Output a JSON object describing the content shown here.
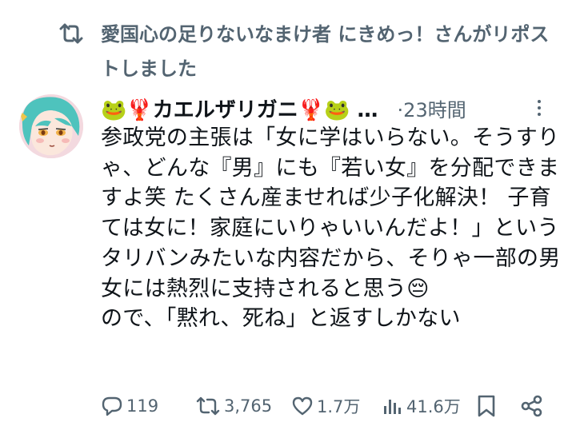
{
  "repost": {
    "icon": "repost-icon",
    "text": "愛国心の足りないなまけ者 にきめっ！さんがリポストしました"
  },
  "post": {
    "author": {
      "avatar": "avatar",
      "display_name": "🐸🦞カエルザリガニ🦞🐸 …"
    },
    "time": "·23時間",
    "body_paragraphs": [
      "参政党の主張は「女に学はいらない。そうすりゃ、どんな『男』にも『若い女』を分配できますよ笑 たくさん産ませれば少子化解決！ 子育ては女に！家庭にいりゃいいんだよ！」というタリバンみたいな内容だから、そりゃ一部の男女には熱烈に支持されると思う😔",
      "ので、「黙れ、死ね」と返すしかない"
    ]
  },
  "actions": {
    "reply": {
      "icon": "reply-icon",
      "count": "119"
    },
    "repost": {
      "icon": "repost-icon",
      "count": "3,765"
    },
    "like": {
      "icon": "heart-icon",
      "count": "1.7万"
    },
    "views": {
      "icon": "views-icon",
      "count": "41.6万"
    },
    "bookmark": {
      "icon": "bookmark-icon"
    },
    "share": {
      "icon": "share-icon"
    }
  },
  "colors": {
    "text_primary": "#0f1419",
    "text_secondary": "#536471",
    "background": "#ffffff"
  }
}
